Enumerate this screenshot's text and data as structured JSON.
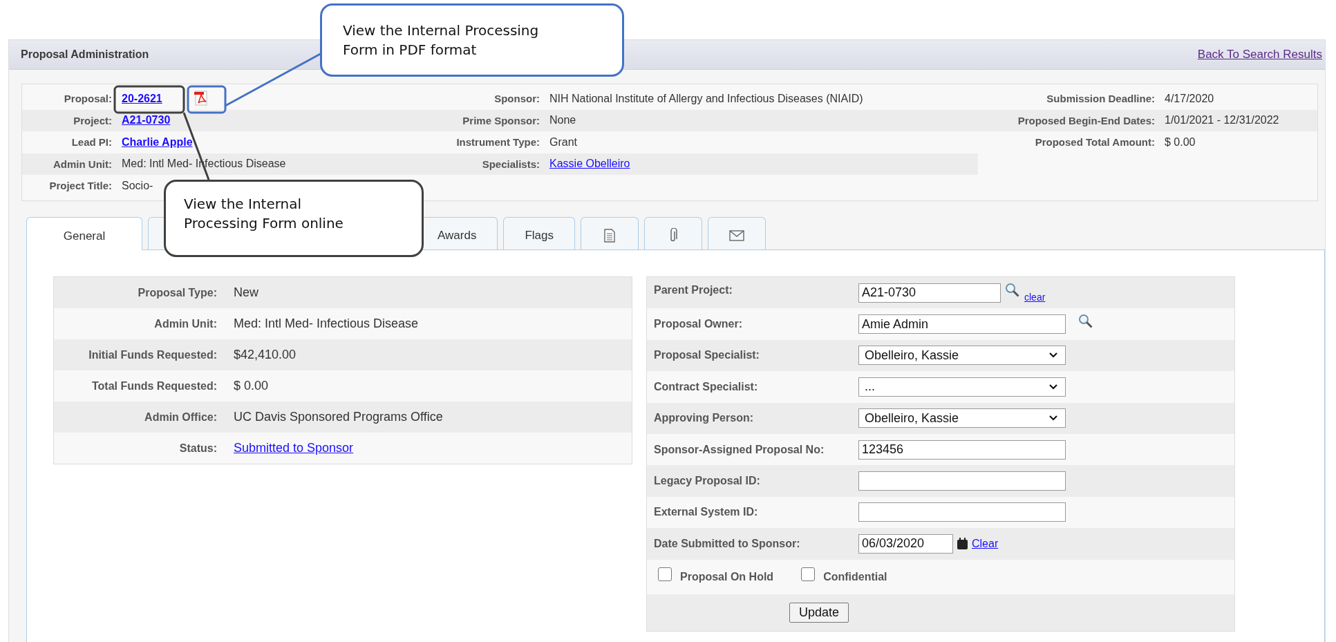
{
  "header": {
    "title": "Proposal Administration",
    "back_link": "Back To Search Results"
  },
  "info": {
    "columns": [
      [
        {
          "label": "Proposal:",
          "value": "20-2621",
          "kind": "pdf-link"
        },
        {
          "label": "Project:",
          "value": "A21-0730",
          "kind": "bold-link"
        },
        {
          "label": "Lead PI:",
          "value": "Charlie Apple",
          "kind": "bold-link"
        },
        {
          "label": "Admin Unit:",
          "value": "Med: Intl Med- Infectious Disease",
          "kind": "text"
        },
        {
          "label": "Project Title:",
          "value": "Socio-",
          "kind": "text"
        }
      ],
      [
        {
          "label": "Sponsor:",
          "value": "NIH National Institute of Allergy and Infectious Diseases (NIAID)",
          "kind": "text"
        },
        {
          "label": "Prime Sponsor:",
          "value": "None",
          "kind": "text"
        },
        {
          "label": "Instrument Type:",
          "value": "Grant",
          "kind": "text"
        },
        {
          "label": "Specialists:",
          "value": "Kassie Obelleiro ",
          "kind": "link"
        }
      ],
      [
        {
          "label": "Submission Deadline:",
          "value": "4/17/2020",
          "kind": "text"
        },
        {
          "label": "Proposed Begin-End Dates:",
          "value": "1/01/2021 - 12/31/2022",
          "kind": "text"
        },
        {
          "label": "Proposed Total Amount:",
          "value": "$ 0.00",
          "kind": "text"
        }
      ]
    ]
  },
  "tabs": [
    {
      "label": "General",
      "kind": "text",
      "selected": true
    },
    {
      "kind": "blank",
      "selected": false
    },
    {
      "label": "Awards",
      "kind": "text",
      "selected": false
    },
    {
      "label": "Flags",
      "kind": "text",
      "selected": false
    },
    {
      "kind": "document",
      "selected": false
    },
    {
      "kind": "paperclip",
      "selected": false
    },
    {
      "kind": "envelope",
      "selected": false
    }
  ],
  "summary": [
    {
      "label": "Proposal Type:",
      "value": "New",
      "kind": "text"
    },
    {
      "label": "Admin Unit:",
      "value": "Med: Intl Med- Infectious Disease",
      "kind": "text"
    },
    {
      "label": "Initial Funds Requested:",
      "value": "$42,410.00",
      "kind": "text"
    },
    {
      "label": "Total Funds Requested:",
      "value": "$ 0.00",
      "kind": "text"
    },
    {
      "label": "Admin Office:",
      "value": "UC Davis Sponsored Programs Office",
      "kind": "text"
    },
    {
      "label": "Status:",
      "value": "Submitted to Sponsor",
      "kind": "link"
    }
  ],
  "form": {
    "fields": [
      {
        "label": "Parent Project:",
        "value": "A21-0730",
        "kind": "lookup-clear",
        "link": "clear"
      },
      {
        "label": "Proposal Owner:",
        "value": "Amie Admin",
        "kind": "lookup"
      },
      {
        "label": "Proposal Specialist:",
        "value": "Obelleiro, Kassie",
        "kind": "select"
      },
      {
        "label": "Contract Specialist:",
        "value": "...",
        "kind": "select"
      },
      {
        "label": "Approving Person:",
        "value": "Obelleiro, Kassie",
        "kind": "select"
      },
      {
        "label": "Sponsor-Assigned Proposal No:",
        "value": "123456",
        "kind": "input"
      },
      {
        "label": "Legacy Proposal ID:",
        "kind": "input"
      },
      {
        "label": "External System ID:",
        "kind": "input"
      },
      {
        "label": "Date Submitted to Sponsor:",
        "value": "06/03/2020",
        "kind": "date",
        "link": "Clear"
      }
    ],
    "checkboxes": [
      {
        "label": "Proposal On Hold",
        "checked": false
      },
      {
        "label": "Confidential",
        "checked": false
      }
    ],
    "button": "Update"
  },
  "annotations": [
    {
      "text": "View the Internal Processing Form in PDF format",
      "color": "#4472c4",
      "kind": "pdf"
    },
    {
      "text": "View the Internal Processing Form online",
      "color": "#404040",
      "kind": "proposal"
    }
  ]
}
